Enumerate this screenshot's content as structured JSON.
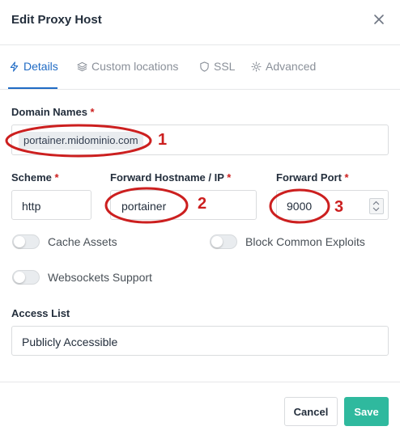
{
  "modal": {
    "title": "Edit Proxy Host"
  },
  "tabs": [
    {
      "label": "Details",
      "icon": "bolt-icon",
      "active": true
    },
    {
      "label": "Custom locations",
      "icon": "layers-icon",
      "active": false
    },
    {
      "label": "SSL",
      "icon": "shield-icon",
      "active": false
    },
    {
      "label": "Advanced",
      "icon": "gear-icon",
      "active": false
    }
  ],
  "form": {
    "required_mark": "*",
    "domain_names": {
      "label": "Domain Names",
      "chip": "portainer.midominio.com"
    },
    "scheme": {
      "label": "Scheme",
      "value": "http"
    },
    "forward_host": {
      "label": "Forward Hostname / IP",
      "value": "portainer"
    },
    "forward_port": {
      "label": "Forward Port",
      "value": "9000"
    },
    "cache_assets": {
      "label": "Cache Assets",
      "enabled": false
    },
    "block_exploits": {
      "label": "Block Common Exploits",
      "enabled": false
    },
    "websockets": {
      "label": "Websockets Support",
      "enabled": false
    },
    "access_list": {
      "label": "Access List",
      "value": "Publicly Accessible"
    }
  },
  "footer": {
    "cancel_label": "Cancel",
    "save_label": "Save"
  },
  "annotations": {
    "marker_1": "1",
    "marker_2": "2",
    "marker_3": "3",
    "color": "#cc1f1f"
  },
  "colors": {
    "accent": "#206bc4",
    "save_button": "#2fb99e",
    "required": "#cd201f"
  }
}
